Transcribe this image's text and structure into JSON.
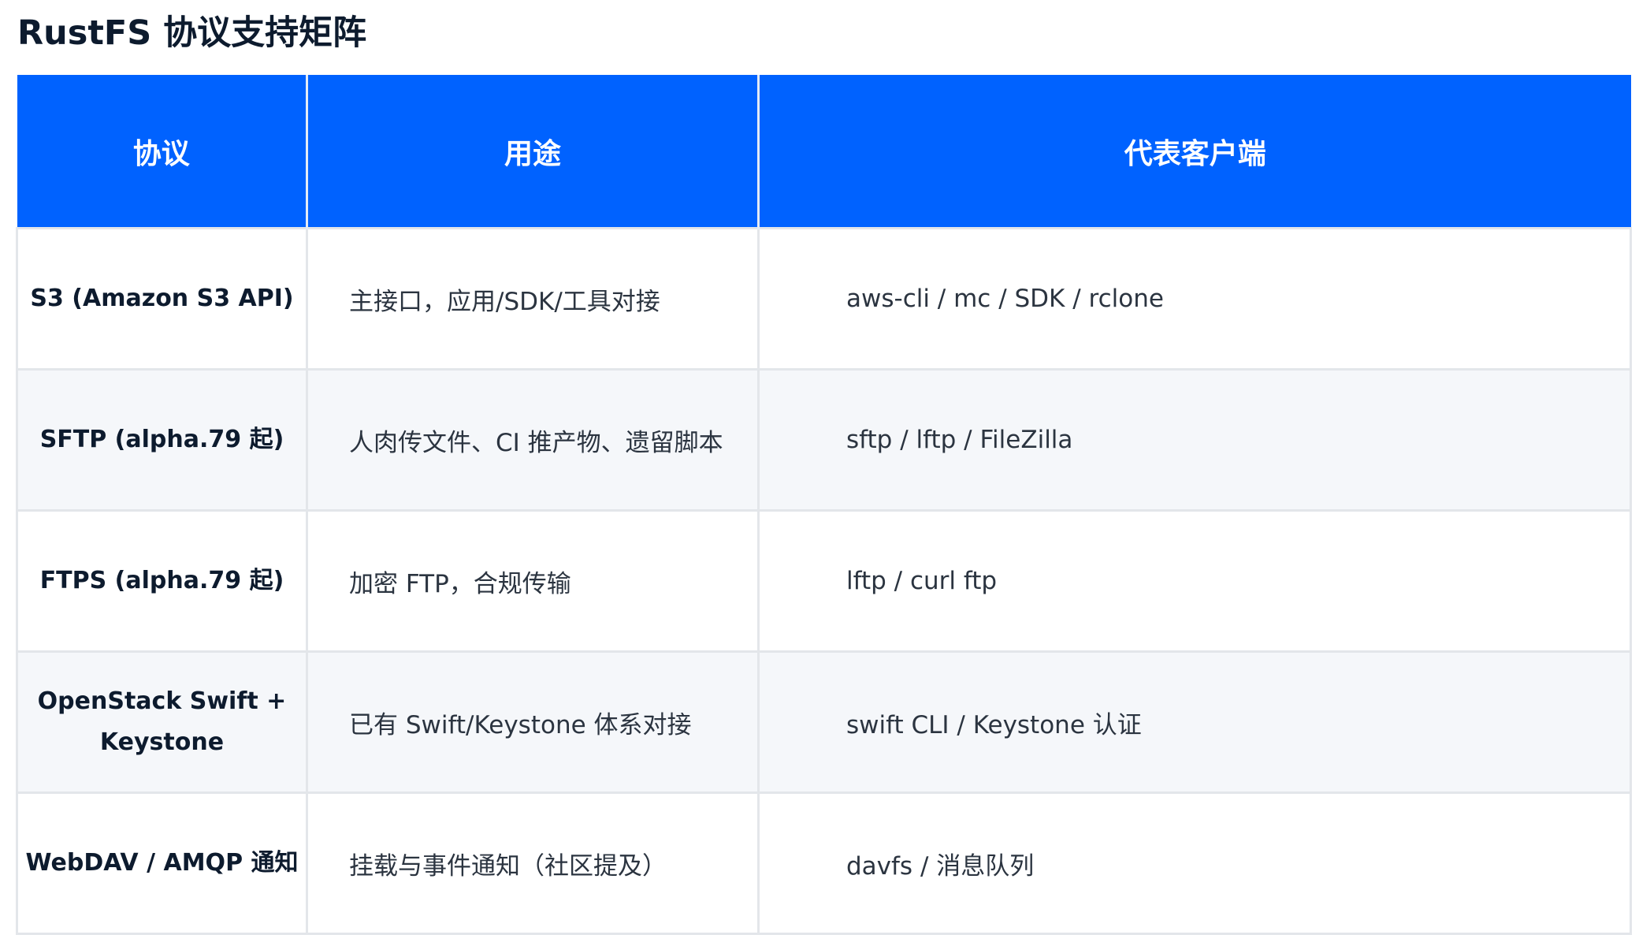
{
  "page": {
    "title": "RustFS 协议支持矩阵"
  },
  "table": {
    "headers": [
      "协议",
      "用途",
      "代表客户端"
    ],
    "rows": [
      {
        "protocol": "S3 (Amazon S3 API)",
        "usage": "主接口，应用/SDK/工具对接",
        "clients": "aws-cli / mc / SDK / rclone"
      },
      {
        "protocol": "SFTP (alpha.79 起)",
        "usage": "人肉传文件、CI 推产物、遗留脚本",
        "clients": "sftp / lftp / FileZilla"
      },
      {
        "protocol": "FTPS (alpha.79 起)",
        "usage": "加密 FTP，合规传输",
        "clients": "lftp / curl ftp"
      },
      {
        "protocol": "OpenStack Swift + Keystone",
        "usage": "已有 Swift/Keystone 体系对接",
        "clients": "swift CLI / Keystone 认证"
      },
      {
        "protocol": "WebDAV / AMQP 通知",
        "usage": "挂载与事件通知（社区提及）",
        "clients": "davfs / 消息队列"
      }
    ]
  },
  "colors": {
    "header_bg": "#0062ff",
    "header_text": "#ffffff",
    "title_text": "#0d1b2e",
    "alt_row_bg": "#f5f7fa",
    "border": "#e3e6ea"
  }
}
